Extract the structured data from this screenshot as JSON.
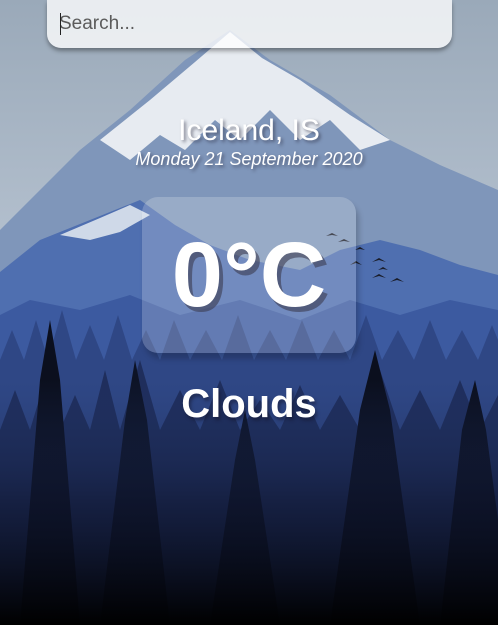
{
  "search": {
    "placeholder": "Search...",
    "value": ""
  },
  "weather": {
    "location": "Iceland, IS",
    "date": "Monday 21 September 2020",
    "temperature": "0°C",
    "condition": "Clouds"
  },
  "background": {
    "scene": "mountain-forest",
    "colors": {
      "sky": "#aebccb",
      "mountain": "#3f5f9d",
      "forest": "#1c2a4f",
      "ground": "#000000"
    }
  }
}
